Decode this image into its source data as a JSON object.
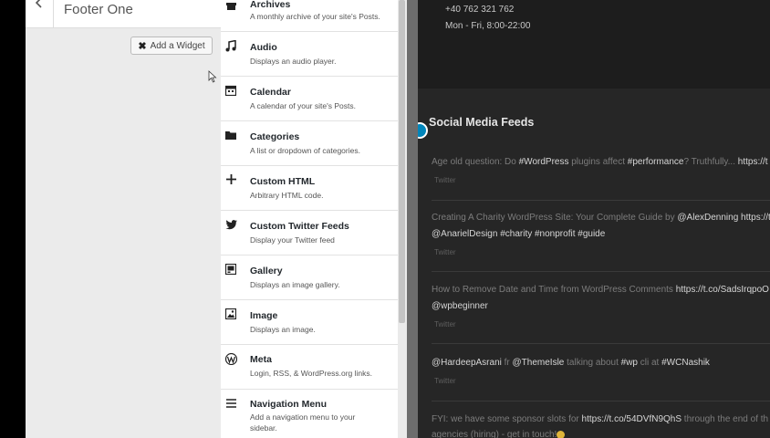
{
  "panel": {
    "title": "Footer One",
    "back_icon": "chevron-left-icon",
    "add_widget_label": "Add a Widget",
    "add_widget_icon": "x-icon"
  },
  "widgets": [
    {
      "name": "Archives",
      "desc": "A monthly archive of your site's Posts.",
      "icon": "archive-icon"
    },
    {
      "name": "Audio",
      "desc": "Displays an audio player.",
      "icon": "music-note-icon"
    },
    {
      "name": "Calendar",
      "desc": "A calendar of your site's Posts.",
      "icon": "calendar-icon"
    },
    {
      "name": "Categories",
      "desc": "A list or dropdown of categories.",
      "icon": "folder-icon"
    },
    {
      "name": "Custom HTML",
      "desc": "Arbitrary HTML code.",
      "icon": "plus-icon"
    },
    {
      "name": "Custom Twitter Feeds",
      "desc": "Display your Twitter feed",
      "icon": "twitter-icon"
    },
    {
      "name": "Gallery",
      "desc": "Displays an image gallery.",
      "icon": "gallery-icon"
    },
    {
      "name": "Image",
      "desc": "Displays an image.",
      "icon": "image-icon"
    },
    {
      "name": "Meta",
      "desc": "Login, RSS, & WordPress.org links.",
      "icon": "wordpress-icon"
    },
    {
      "name": "Navigation Menu",
      "desc": "Add a navigation menu to your",
      "desc2": "sidebar.",
      "icon": "menu-icon"
    }
  ],
  "preview": {
    "phone": "+40 762 321 762",
    "hours": "Mon - Fri, 8:00-22:00",
    "section_title": "Social Media Feeds",
    "tweets": [
      {
        "line1": [
          "Age old question: Do ",
          "#WordPress",
          " plugins affect ",
          "#performance",
          "? Truthfully... ",
          "https://t"
        ],
        "source": "Twitter"
      },
      {
        "line1": [
          "Creating A Charity WordPress Site: Your Complete Guide by ",
          "@AlexDenning",
          " ",
          "https://t.c"
        ],
        "line2": [
          "@AnarielDesign",
          " ",
          "#charity",
          " ",
          "#nonprofit",
          " ",
          "#guide"
        ],
        "source": "Twitter"
      },
      {
        "line1": [
          "How to Remove Date and Time from WordPress Comments ",
          "https://t.co/SadsIrqpoO"
        ],
        "line2": [
          "@wpbeginner"
        ],
        "source": "Twitter"
      },
      {
        "line1": [
          "@HardeepAsrani",
          " fr ",
          "@ThemeIsle",
          " talking about ",
          "#wp",
          " cli at ",
          "#WCNashik"
        ],
        "source": "Twitter"
      },
      {
        "line1": [
          "FYI: we have some sponsor slots for ",
          "https://t.co/54DVfN9QhS",
          " through the end of th"
        ],
        "line2": [
          "agencies (hiring) - get in touch!"
        ]
      }
    ]
  },
  "colors": {
    "accent": "#0085ba",
    "preview_bg": "#262626",
    "panel_bg": "#ebebeb"
  }
}
